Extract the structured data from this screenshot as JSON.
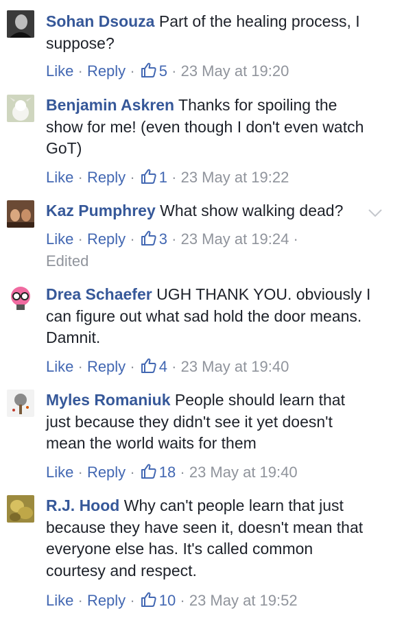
{
  "actions": {
    "like_label": "Like",
    "reply_label": "Reply",
    "separator": "·"
  },
  "comments": [
    {
      "author": "Sohan Dsouza",
      "text": "Part of the healing process, I suppose?",
      "likes": "5",
      "time": "23 May at 19:20",
      "avatar": "avatar-sohan-dsouza"
    },
    {
      "author": "Benjamin Askren",
      "text": "Thanks for spoiling the show for me! (even though I don't even watch GoT)",
      "likes": "1",
      "time": "23 May at 19:22",
      "avatar": "avatar-benjamin-askren"
    },
    {
      "author": "Kaz Pumphrey",
      "text": "What show walking dead?",
      "likes": "3",
      "time": "23 May at 19:24",
      "edited": "Edited",
      "avatar": "avatar-kaz-pumphrey"
    },
    {
      "author": "Drea Schaefer",
      "text": "UGH THANK YOU. obviously I can figure out what sad hold the door means. Damnit.",
      "likes": "4",
      "time": "23 May at 19:40",
      "avatar": "avatar-drea-schaefer"
    },
    {
      "author": "Myles Romaniuk",
      "text": "People should learn that just because they didn't see it yet doesn't mean the world waits for them",
      "likes": "18",
      "time": "23 May at 19:40",
      "avatar": "avatar-myles-romaniuk"
    },
    {
      "author": "R.J. Hood",
      "text": "Why can't people learn that just because they have seen it, doesn't mean that everyone else has. It's called common courtesy and respect.",
      "likes": "10",
      "time": "23 May at 19:52",
      "avatar": "avatar-rj-hood"
    }
  ],
  "colors": {
    "author": "#365899",
    "link": "#4267b2",
    "meta": "#90949c",
    "text": "#1d2129"
  },
  "icons": {
    "like": "thumbs-up-icon",
    "options": "chevron-down-icon"
  }
}
